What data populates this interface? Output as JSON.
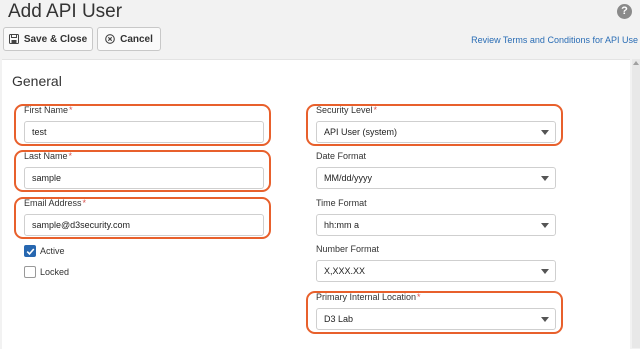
{
  "page": {
    "title": "Add API User"
  },
  "icons": {
    "help": "question-circle-icon",
    "save": "floppy-disk-icon",
    "cancel": "cancel-circle-icon",
    "dropdown": "caret-down-icon",
    "check": "check-icon"
  },
  "toolbar": {
    "save_label": "Save & Close",
    "cancel_label": "Cancel",
    "terms_link": "Review Terms and Conditions for API Use"
  },
  "section": {
    "title": "General"
  },
  "form": {
    "first_name": {
      "label": "First Name",
      "required": "*",
      "value": "test"
    },
    "last_name": {
      "label": "Last Name",
      "required": "*",
      "value": "sample"
    },
    "email": {
      "label": "Email Address",
      "required": "*",
      "value": "sample@d3security.com"
    },
    "active": {
      "label": "Active",
      "checked": true
    },
    "locked": {
      "label": "Locked",
      "checked": false
    },
    "security_level": {
      "label": "Security Level",
      "required": "*",
      "value": "API User (system)"
    },
    "date_format": {
      "label": "Date Format",
      "value": "MM/dd/yyyy"
    },
    "time_format": {
      "label": "Time Format",
      "value": "hh:mm a"
    },
    "number_format": {
      "label": "Number Format",
      "value": "X,XXX.XX"
    },
    "primary_location": {
      "label": "Primary Internal Location",
      "required": "*",
      "value": "D3 Lab"
    }
  },
  "colors": {
    "highlight": "#e8602c",
    "link": "#2a6db5",
    "checkbox_checked": "#2767b0",
    "required": "#d9534f"
  }
}
